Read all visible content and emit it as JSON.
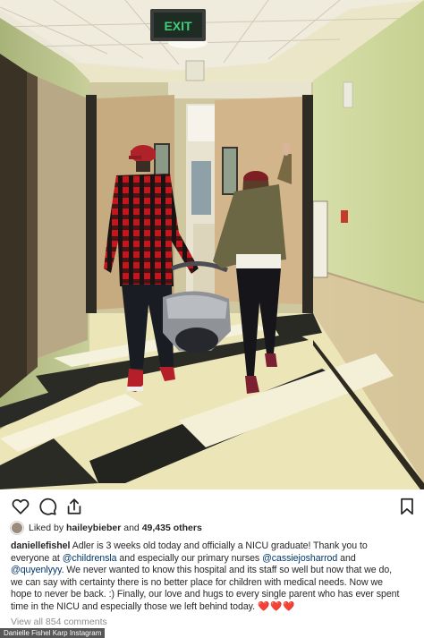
{
  "photo": {
    "exit_sign": "EXIT"
  },
  "post": {
    "likes": {
      "prefix": "Liked by",
      "user": "haileybieber",
      "middle": "and",
      "count": "49,435 others"
    },
    "caption": {
      "username": "daniellefishel",
      "line1_text": "Adler is 3 weeks old today and officially a NICU graduate! Thank you to",
      "line2_pre": "everyone at",
      "mention_childrens": "@childrensla",
      "line2_mid": "and especially our primary nurses",
      "mention_cassie": "@cassiejosharrod",
      "line2_end": "and",
      "mention_quyen": "@quyenlyyy",
      "line3_text": ". We never wanted to know this hospital and its staff so well but now that we do,",
      "line4_text": "we can say with certainty there is no better place for children with medical needs. Now we",
      "line5_text": "hope to never be back. :) Finally, our love and hugs to every single parent who has ever spent",
      "line6_text": "time in the NICU and especially those we left behind today.",
      "hearts": "❤️❤️❤️"
    },
    "view_comments": "View all 854 comments"
  },
  "credit": "Danielle Fishel Karp Instagram",
  "icons": {
    "like": "heart-icon",
    "comment": "comment-icon",
    "share": "share-icon",
    "save": "bookmark-icon",
    "liker_avatar": "avatar"
  },
  "colors": {
    "mention": "#003569",
    "muted": "#8e8e8e",
    "text": "#262626",
    "exit_sign": "#3ecf7a"
  }
}
